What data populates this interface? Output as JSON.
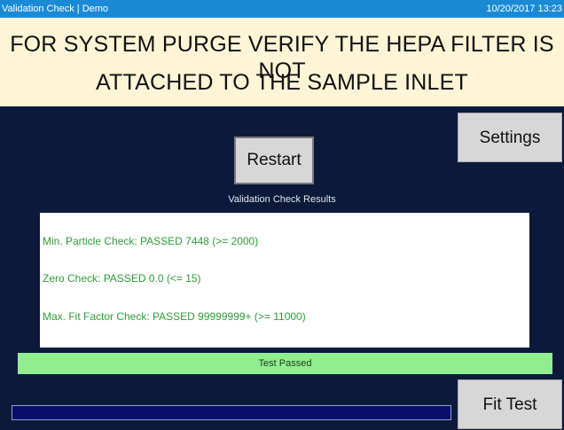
{
  "window": {
    "title": "Validation Check | Demo",
    "datetime": "10/20/2017 13:23"
  },
  "banner": {
    "line1": "FOR SYSTEM PURGE VERIFY THE HEPA FILTER IS NOT",
    "line2": "ATTACHED TO THE SAMPLE INLET"
  },
  "buttons": {
    "settings": "Settings",
    "restart": "Restart",
    "fit_test": "Fit Test"
  },
  "results": {
    "caption": "Validation Check Results",
    "items": [
      "Min. Particle Check: PASSED 7448 (>= 2000)",
      "Zero Check: PASSED 0.0 (<= 15)",
      "Max. Fit Factor Check: PASSED 99999999+ (>= 11000)"
    ]
  },
  "status": {
    "text": "Test Passed"
  },
  "progress": {
    "value_percent": 0
  },
  "colors": {
    "titlebar": "#1b8ad6",
    "banner_bg": "#fdf5d6",
    "panel_bg": "#0b1a3b",
    "passed_text": "#2e9c39",
    "status_bar": "#90ee90"
  }
}
